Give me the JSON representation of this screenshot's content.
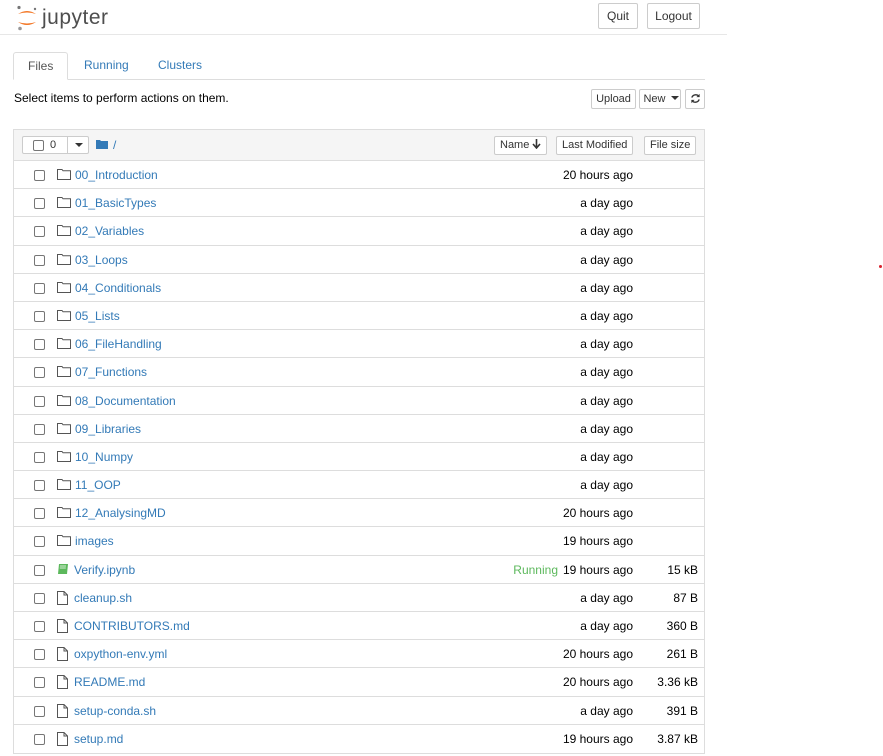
{
  "header": {
    "logo_text": "jupyter",
    "quit_label": "Quit",
    "logout_label": "Logout"
  },
  "tabs": [
    {
      "label": "Files",
      "active": true
    },
    {
      "label": "Running",
      "active": false
    },
    {
      "label": "Clusters",
      "active": false
    }
  ],
  "toolbar": {
    "instructions": "Select items to perform actions on them.",
    "upload_label": "Upload",
    "new_label": "New",
    "refresh_icon": "refresh-icon"
  },
  "list_header": {
    "selected_count": "0",
    "path": "/",
    "name_label": "Name",
    "last_modified_label": "Last Modified",
    "file_size_label": "File size"
  },
  "rows": [
    {
      "name": "00_Introduction",
      "type": "folder",
      "status": "",
      "modified": "20 hours ago",
      "size": ""
    },
    {
      "name": "01_BasicTypes",
      "type": "folder",
      "status": "",
      "modified": "a day ago",
      "size": ""
    },
    {
      "name": "02_Variables",
      "type": "folder",
      "status": "",
      "modified": "a day ago",
      "size": ""
    },
    {
      "name": "03_Loops",
      "type": "folder",
      "status": "",
      "modified": "a day ago",
      "size": ""
    },
    {
      "name": "04_Conditionals",
      "type": "folder",
      "status": "",
      "modified": "a day ago",
      "size": ""
    },
    {
      "name": "05_Lists",
      "type": "folder",
      "status": "",
      "modified": "a day ago",
      "size": ""
    },
    {
      "name": "06_FileHandling",
      "type": "folder",
      "status": "",
      "modified": "a day ago",
      "size": ""
    },
    {
      "name": "07_Functions",
      "type": "folder",
      "status": "",
      "modified": "a day ago",
      "size": ""
    },
    {
      "name": "08_Documentation",
      "type": "folder",
      "status": "",
      "modified": "a day ago",
      "size": ""
    },
    {
      "name": "09_Libraries",
      "type": "folder",
      "status": "",
      "modified": "a day ago",
      "size": ""
    },
    {
      "name": "10_Numpy",
      "type": "folder",
      "status": "",
      "modified": "a day ago",
      "size": ""
    },
    {
      "name": "11_OOP",
      "type": "folder",
      "status": "",
      "modified": "a day ago",
      "size": ""
    },
    {
      "name": "12_AnalysingMD",
      "type": "folder",
      "status": "",
      "modified": "20 hours ago",
      "size": ""
    },
    {
      "name": "images",
      "type": "folder",
      "status": "",
      "modified": "19 hours ago",
      "size": ""
    },
    {
      "name": "Verify.ipynb",
      "type": "notebook",
      "status": "Running",
      "modified": "19 hours ago",
      "size": "15 kB"
    },
    {
      "name": "cleanup.sh",
      "type": "file",
      "status": "",
      "modified": "a day ago",
      "size": "87 B"
    },
    {
      "name": "CONTRIBUTORS.md",
      "type": "file",
      "status": "",
      "modified": "a day ago",
      "size": "360 B"
    },
    {
      "name": "oxpython-env.yml",
      "type": "file",
      "status": "",
      "modified": "20 hours ago",
      "size": "261 B"
    },
    {
      "name": "README.md",
      "type": "file",
      "status": "",
      "modified": "20 hours ago",
      "size": "3.36 kB"
    },
    {
      "name": "setup-conda.sh",
      "type": "file",
      "status": "",
      "modified": "a day ago",
      "size": "391 B"
    },
    {
      "name": "setup.md",
      "type": "file",
      "status": "",
      "modified": "19 hours ago",
      "size": "3.87 kB"
    }
  ],
  "colors": {
    "link": "#337ab7",
    "running": "#5cb85c",
    "logo_orange": "#f37726"
  }
}
